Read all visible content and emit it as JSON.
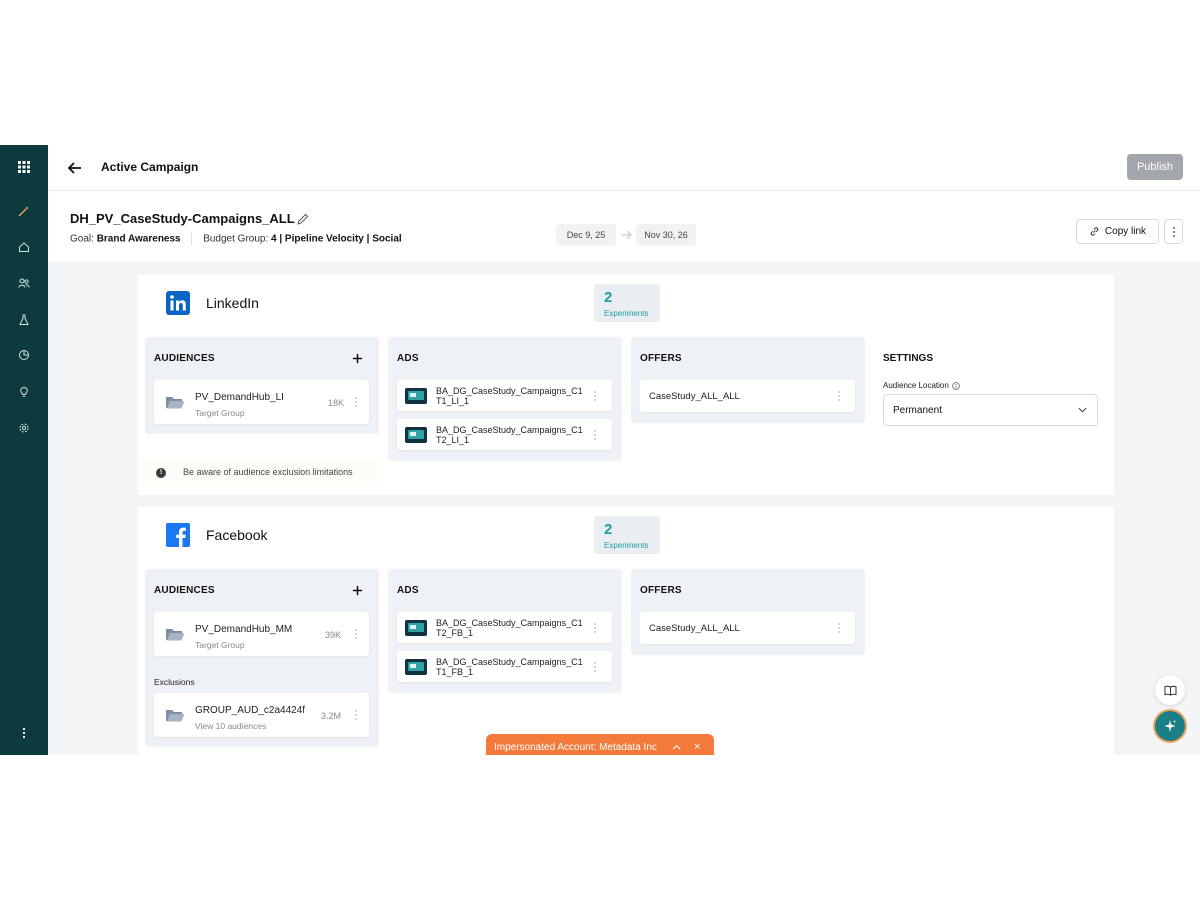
{
  "topbar": {
    "title": "Active Campaign",
    "publish_label": "Publish"
  },
  "campaign": {
    "name": "DH_PV_CaseStudy-Campaigns_ALL",
    "goal_label": "Goal:",
    "goal_value": "Brand Awareness",
    "budget_label": "Budget Group:",
    "budget_value": "4 | Pipeline Velocity | Social",
    "start_date": "Dec 9, 25",
    "end_date": "Nov 30, 26",
    "copy_link_label": "Copy link"
  },
  "linkedin": {
    "name": "LinkedIn",
    "experiments_count": "2",
    "experiments_label": "Experiments",
    "audiences_title": "AUDIENCES",
    "ads_title": "ADS",
    "offers_title": "OFFERS",
    "settings_title": "SETTINGS",
    "audience": {
      "name": "PV_DemandHub_LI",
      "sub": "Target Group",
      "size": "18K"
    },
    "ads": [
      {
        "name": "BA_DG_CaseStudy_Campaigns_C1T1_LI_1"
      },
      {
        "name": "BA_DG_CaseStudy_Campaigns_C1T2_LI_1"
      }
    ],
    "offer": {
      "name": "CaseStudy_ALL_ALL"
    },
    "audience_location_label": "Audience Location",
    "audience_location_value": "Permanent",
    "warning": "Be aware of audience exclusion limitations"
  },
  "facebook": {
    "name": "Facebook",
    "experiments_count": "2",
    "experiments_label": "Experiments",
    "audiences_title": "AUDIENCES",
    "ads_title": "ADS",
    "offers_title": "OFFERS",
    "audience": {
      "name": "PV_DemandHub_MM",
      "sub": "Target Group",
      "size": "39K"
    },
    "exclusions_label": "Exclusions",
    "exclusion": {
      "name": "GROUP_AUD_c2a4424f",
      "sub": "View 10 audiences",
      "size": "3.2M"
    },
    "ads": [
      {
        "name": "BA_DG_CaseStudy_Campaigns_C1T2_FB_1"
      },
      {
        "name": "BA_DG_CaseStudy_Campaigns_C1T1_FB_1"
      }
    ],
    "offer": {
      "name": "CaseStudy_ALL_ALL"
    }
  },
  "impersonation": {
    "label": "Impersonated Account:",
    "account": "Metadata Inc",
    "close": "×"
  },
  "colors": {
    "sidebar": "#0c3a3d",
    "accent": "#1a9ba2",
    "impersonation": "#f47a3c",
    "linkedin": "#0a66c2",
    "facebook": "#1877f2"
  }
}
